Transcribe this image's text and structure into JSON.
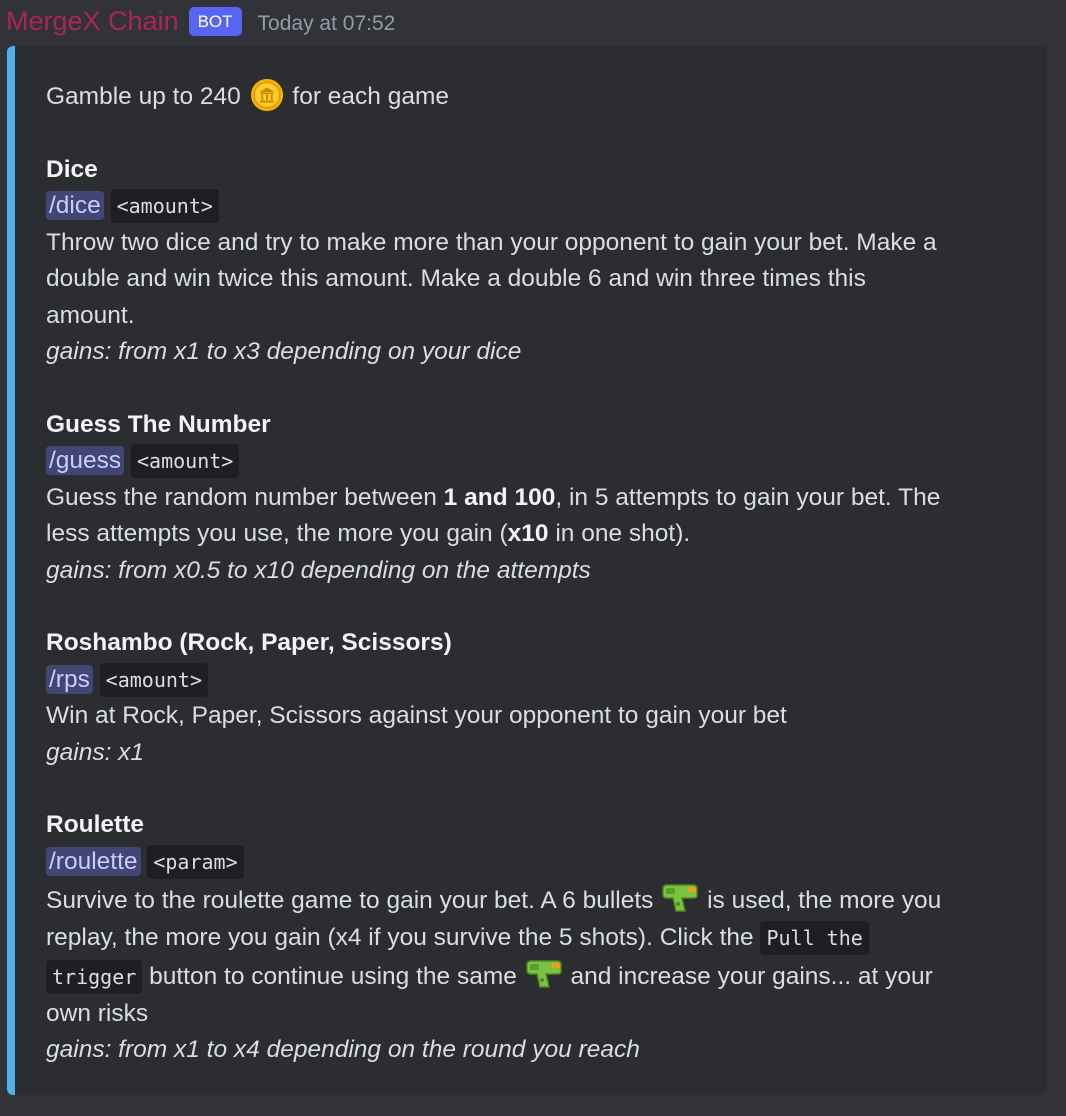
{
  "message": {
    "author": "MergeX Chain",
    "bot_tag": "BOT",
    "timestamp": "Today at 07:52"
  },
  "colors": {
    "author": "#a8265a",
    "bot_tag_bg": "#5865f2",
    "embed_border": "#4fb1e6",
    "embed_bg": "#2b2d31",
    "page_bg": "#313338",
    "command_bg": "#414675"
  },
  "icons": {
    "coin": "coin-icon",
    "gun": "water-pistol-icon"
  },
  "intro": {
    "before": "Gamble up to 240",
    "after": "for each game"
  },
  "games": {
    "dice": {
      "title": "Dice",
      "command": "/dice",
      "param": "<amount>",
      "desc_line1": "Throw two dice and try to make more than your opponent to gain your bet. Make a",
      "desc_line2": "double and win twice this amount. Make a double 6 and win three times this",
      "desc_line3": "amount.",
      "gains": "gains: from x1 to x3 depending on your dice"
    },
    "guess": {
      "title": "Guess The Number",
      "command": "/guess",
      "param": "<amount>",
      "desc_part1": "Guess the random number between ",
      "desc_bold1": "1 and 100",
      "desc_part2": ", in 5 attempts to gain your bet. The",
      "desc_part3": "less attempts you use, the more you gain (",
      "desc_bold2": "x10",
      "desc_part4": " in one shot).",
      "gains": "gains: from x0.5 to x10 depending on the attempts"
    },
    "rps": {
      "title": "Roshambo (Rock, Paper, Scissors)",
      "command": "/rps",
      "param": "<amount>",
      "desc": "Win at Rock, Paper, Scissors against your opponent to gain your bet",
      "gains": "gains: x1"
    },
    "roulette": {
      "title": "Roulette",
      "command": "/roulette",
      "param": "<param>",
      "desc_part1": "Survive to the roulette game to gain your bet. A 6 bullets",
      "desc_part2": "is used, the more you",
      "desc_part3": "replay, the more you gain (x4 if you survive the 5 shots). Click the",
      "code1": "Pull the",
      "code2": "trigger",
      "desc_part4": "button to continue using the same",
      "desc_part5": "and increase your gains... at your",
      "desc_part6": "own risks",
      "gains": "gains: from x1 to x4 depending on the round you reach"
    }
  }
}
